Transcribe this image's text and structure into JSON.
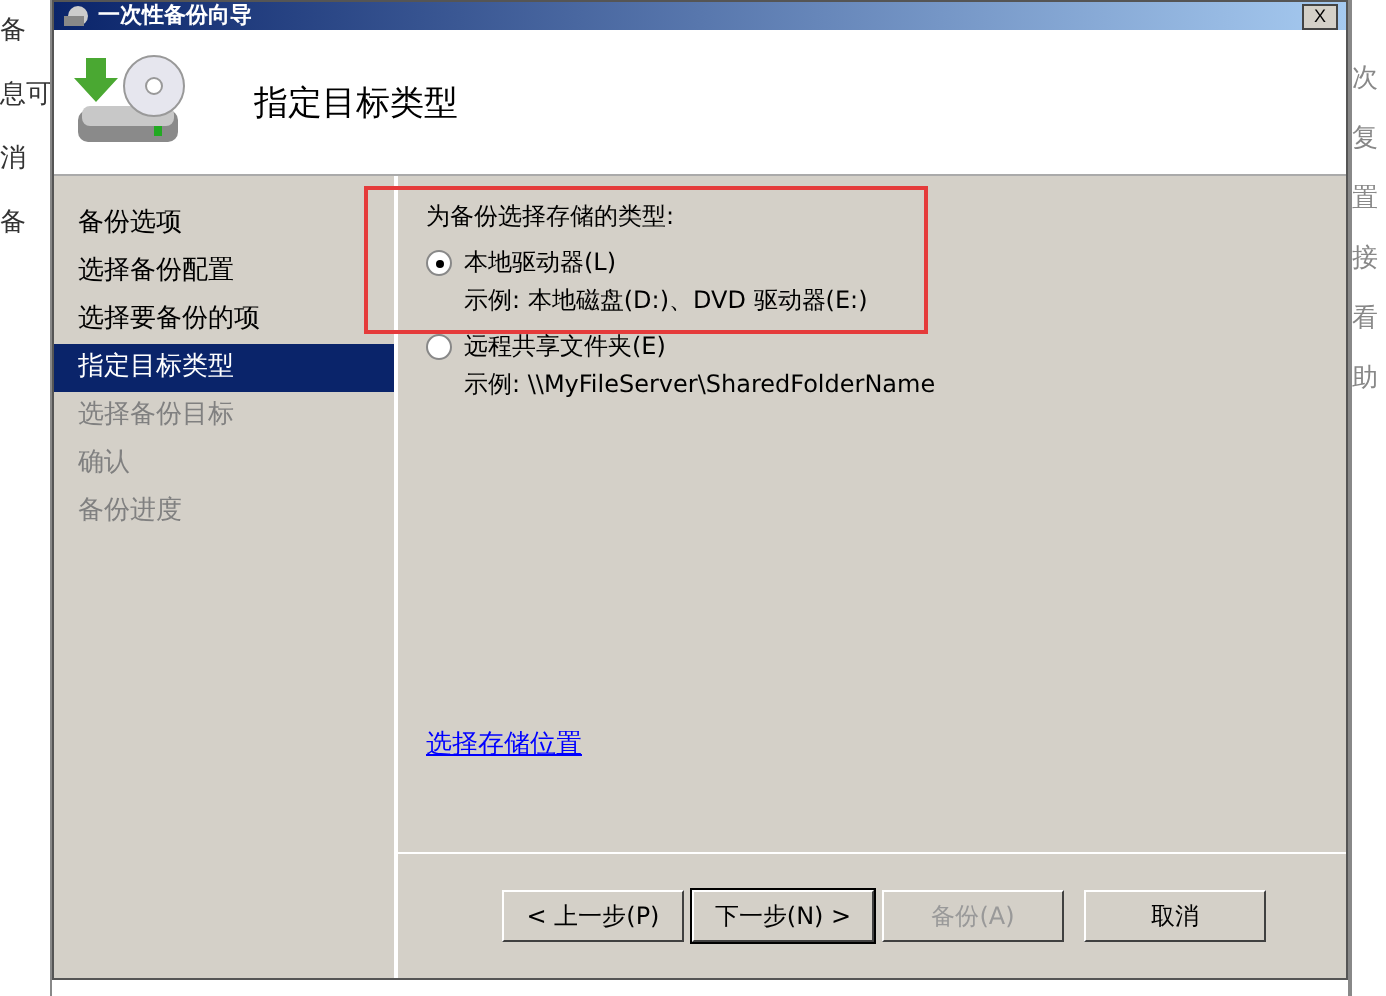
{
  "background_left": [
    "备",
    "息可",
    "消",
    "备"
  ],
  "background_right": [
    "次",
    "复",
    "置",
    "接",
    "看",
    "助"
  ],
  "window": {
    "title": "一次性备份向导",
    "close": "X"
  },
  "header": {
    "title": "指定目标类型"
  },
  "steps": [
    {
      "label": "备份选项",
      "selected": false,
      "disabled": false
    },
    {
      "label": "选择备份配置",
      "selected": false,
      "disabled": false
    },
    {
      "label": "选择要备份的项",
      "selected": false,
      "disabled": false
    },
    {
      "label": "指定目标类型",
      "selected": true,
      "disabled": false
    },
    {
      "label": "选择备份目标",
      "selected": false,
      "disabled": true
    },
    {
      "label": "确认",
      "selected": false,
      "disabled": true
    },
    {
      "label": "备份进度",
      "selected": false,
      "disabled": true
    }
  ],
  "prompt": "为备份选择存储的类型:",
  "options": [
    {
      "label": "本地驱动器(L)",
      "example": "示例: 本地磁盘(D:)、DVD 驱动器(E:)",
      "selected": true,
      "highlighted": true
    },
    {
      "label": "远程共享文件夹(E)",
      "example": "示例: \\\\MyFileServer\\SharedFolderName",
      "selected": false,
      "highlighted": false
    }
  ],
  "link": "选择存储位置",
  "buttons": [
    {
      "label": "< 上一步(P)",
      "disabled": false,
      "default": false
    },
    {
      "label": "下一步(N) >",
      "disabled": false,
      "default": true
    },
    {
      "label": "备份(A)",
      "disabled": true,
      "default": false
    },
    {
      "label": "取消",
      "disabled": false,
      "default": false
    }
  ]
}
